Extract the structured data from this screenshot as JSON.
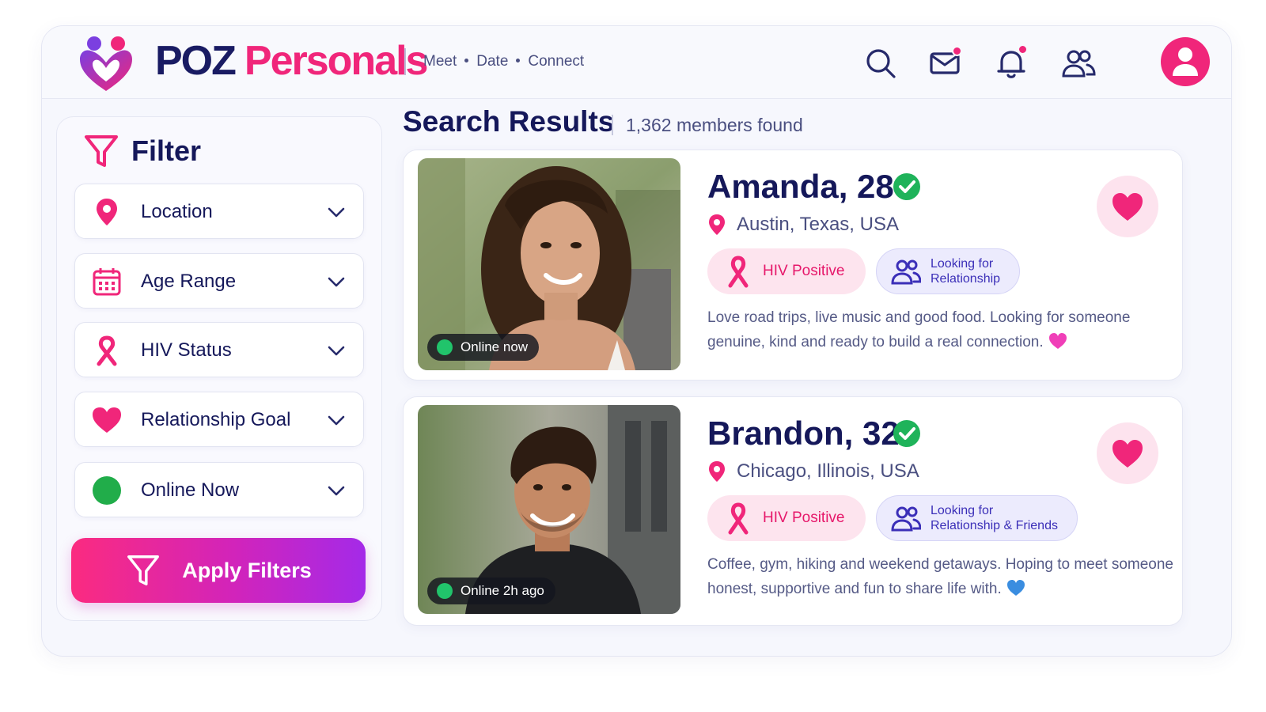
{
  "brand": {
    "name_part1": "POZ",
    "name_part2": "Personals",
    "tagline": [
      "Meet",
      "Date",
      "Connect"
    ]
  },
  "header_icons": [
    "search-icon",
    "mail-icon",
    "bell-icon",
    "users-icon",
    "user-avatar-icon"
  ],
  "colors": {
    "brand_navy": "#191b63",
    "brand_pink": "#f0267a",
    "online_green": "#21c46b",
    "purple": "#3b2fb8"
  },
  "sidebar": {
    "title": "Filter",
    "filters": [
      {
        "label": "Location",
        "icon": "location-pin-icon"
      },
      {
        "label": "Age Range",
        "icon": "calendar-icon"
      },
      {
        "label": "HIV Status",
        "icon": "ribbon-icon"
      },
      {
        "label": "Relationship Goal",
        "icon": "heart-icon"
      },
      {
        "label": "Online Now",
        "icon": "green-dot-icon"
      }
    ],
    "apply_label": "Apply Filters"
  },
  "results": {
    "title": "Search Results",
    "count": "1,362 members found",
    "profiles": [
      {
        "name": "Amanda, 28",
        "location": "Austin, Texas, USA",
        "status": "Online now",
        "hiv_tag": "HIV Positive",
        "looking_line1": "Looking for",
        "looking_line2": "Relationship",
        "bio": "Love road trips, live music and good food. Looking for someone genuine, kind and ready to build a real connection.",
        "emoji": "pink-heart-emoji"
      },
      {
        "name": "Brandon, 32",
        "location": "Chicago, Illinois, USA",
        "status": "Online 2h ago",
        "hiv_tag": "HIV Positive",
        "looking_line1": "Looking for",
        "looking_line2": "Relationship & Friends",
        "bio": "Coffee, gym, hiking and weekend getaways. Hoping to meet someone honest, supportive and fun to share life with.",
        "emoji": "blue-heart-emoji"
      }
    ]
  }
}
